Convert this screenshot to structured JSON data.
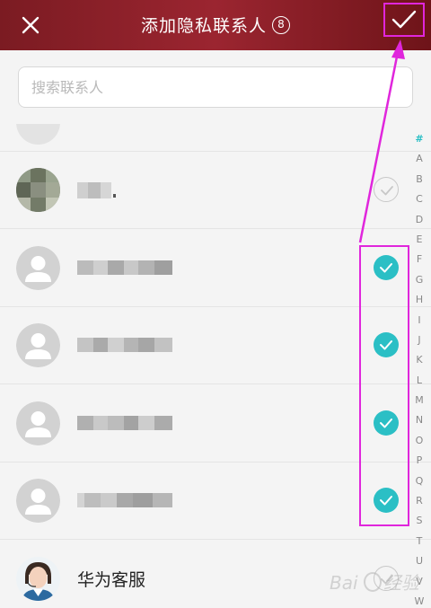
{
  "header": {
    "title": "添加隐私联系人",
    "selected_count": "8",
    "accent_color": "#8e1f29"
  },
  "search": {
    "placeholder": "搜索联系人"
  },
  "contacts": [
    {
      "name": "",
      "checked": false,
      "avatar": "photo-blurred"
    },
    {
      "name": "",
      "checked": true,
      "avatar": "default-person-icon"
    },
    {
      "name": "",
      "checked": true,
      "avatar": "default-person-icon"
    },
    {
      "name": "",
      "checked": true,
      "avatar": "default-person-icon"
    },
    {
      "name": "",
      "checked": true,
      "avatar": "default-person-icon"
    },
    {
      "name": "华为客服",
      "checked": false,
      "avatar": "service-agent-photo"
    }
  ],
  "index_letters": [
    "#",
    "A",
    "B",
    "C",
    "D",
    "E",
    "F",
    "G",
    "H",
    "I",
    "J",
    "K",
    "L",
    "M",
    "N",
    "O",
    "P",
    "Q",
    "R",
    "S",
    "T",
    "U",
    "V",
    "W"
  ],
  "check_color": "#2bbfc5",
  "annotation_color": "#e026dc"
}
